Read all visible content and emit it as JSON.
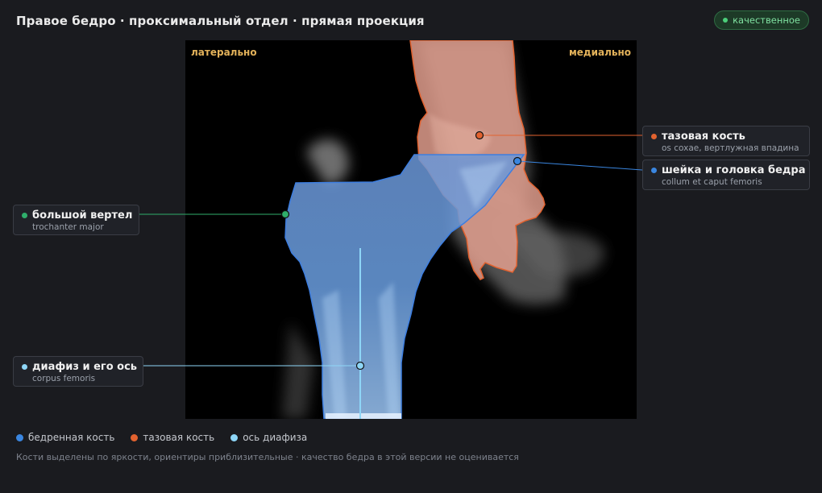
{
  "header": {
    "title": "Правое бедро · проксимальный отдел · прямая проекция",
    "badge_label": "качественное"
  },
  "viewer": {
    "orientation_left": "латерально",
    "orientation_right": "медиально"
  },
  "callouts": {
    "pelvis": {
      "name": "тазовая кость",
      "latin": "os coxae, вертлужная впадина",
      "color": "#e2622f"
    },
    "neck": {
      "name": "шейка и головка бедра",
      "latin": "collum et caput femoris",
      "color": "#3a86e0"
    },
    "trochanter": {
      "name": "большой вертел",
      "latin": "trochanter major",
      "color": "#2fae6b"
    },
    "shaft": {
      "name": "диафиз и его ось",
      "latin": "corpus femoris",
      "color": "#8ed6f7"
    }
  },
  "legend": [
    {
      "label": "бедренная кость",
      "color": "#3a86e0"
    },
    {
      "label": "тазовая кость",
      "color": "#e2622f"
    },
    {
      "label": "ось диафиза",
      "color": "#8ed6f7"
    }
  ],
  "footnote": "Кости выделены по яркости, ориентиры приблизительные · качество бедра в этой версии не оценивается",
  "colors": {
    "femur_fill": "#5c8fd6",
    "femur_outline": "#3d7ee0",
    "pelvis_fill": "#e9a38f",
    "pelvis_outline": "#e2622f",
    "axis": "#8ed6f7",
    "badge": "#4ccf7a"
  }
}
